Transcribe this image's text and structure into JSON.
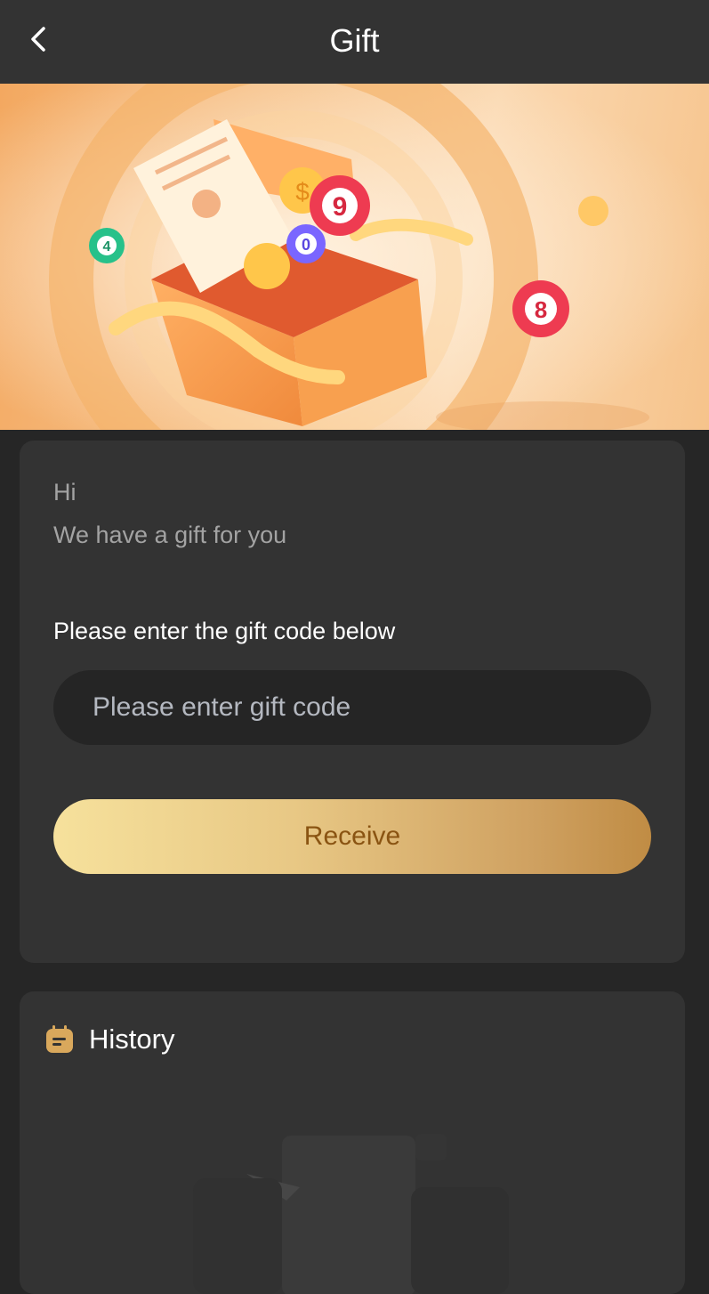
{
  "header": {
    "title": "Gift",
    "back_icon": "chevron-left-icon"
  },
  "banner": {
    "lottery_balls": [
      "4",
      "9",
      "0",
      "8"
    ],
    "coin_symbol": "$"
  },
  "gift_card": {
    "greeting": "Hi",
    "subgreeting": "We have a gift for you",
    "code_label": "Please enter the gift code below",
    "code_input": {
      "value": "",
      "placeholder": "Please enter gift code"
    },
    "receive_label": "Receive"
  },
  "history": {
    "title": "History",
    "icon": "clipboard-icon"
  },
  "colors": {
    "page_bg": "#262626",
    "card_bg": "#333333",
    "accent_gold": "#d9a85c",
    "button_text": "#8a5412"
  }
}
